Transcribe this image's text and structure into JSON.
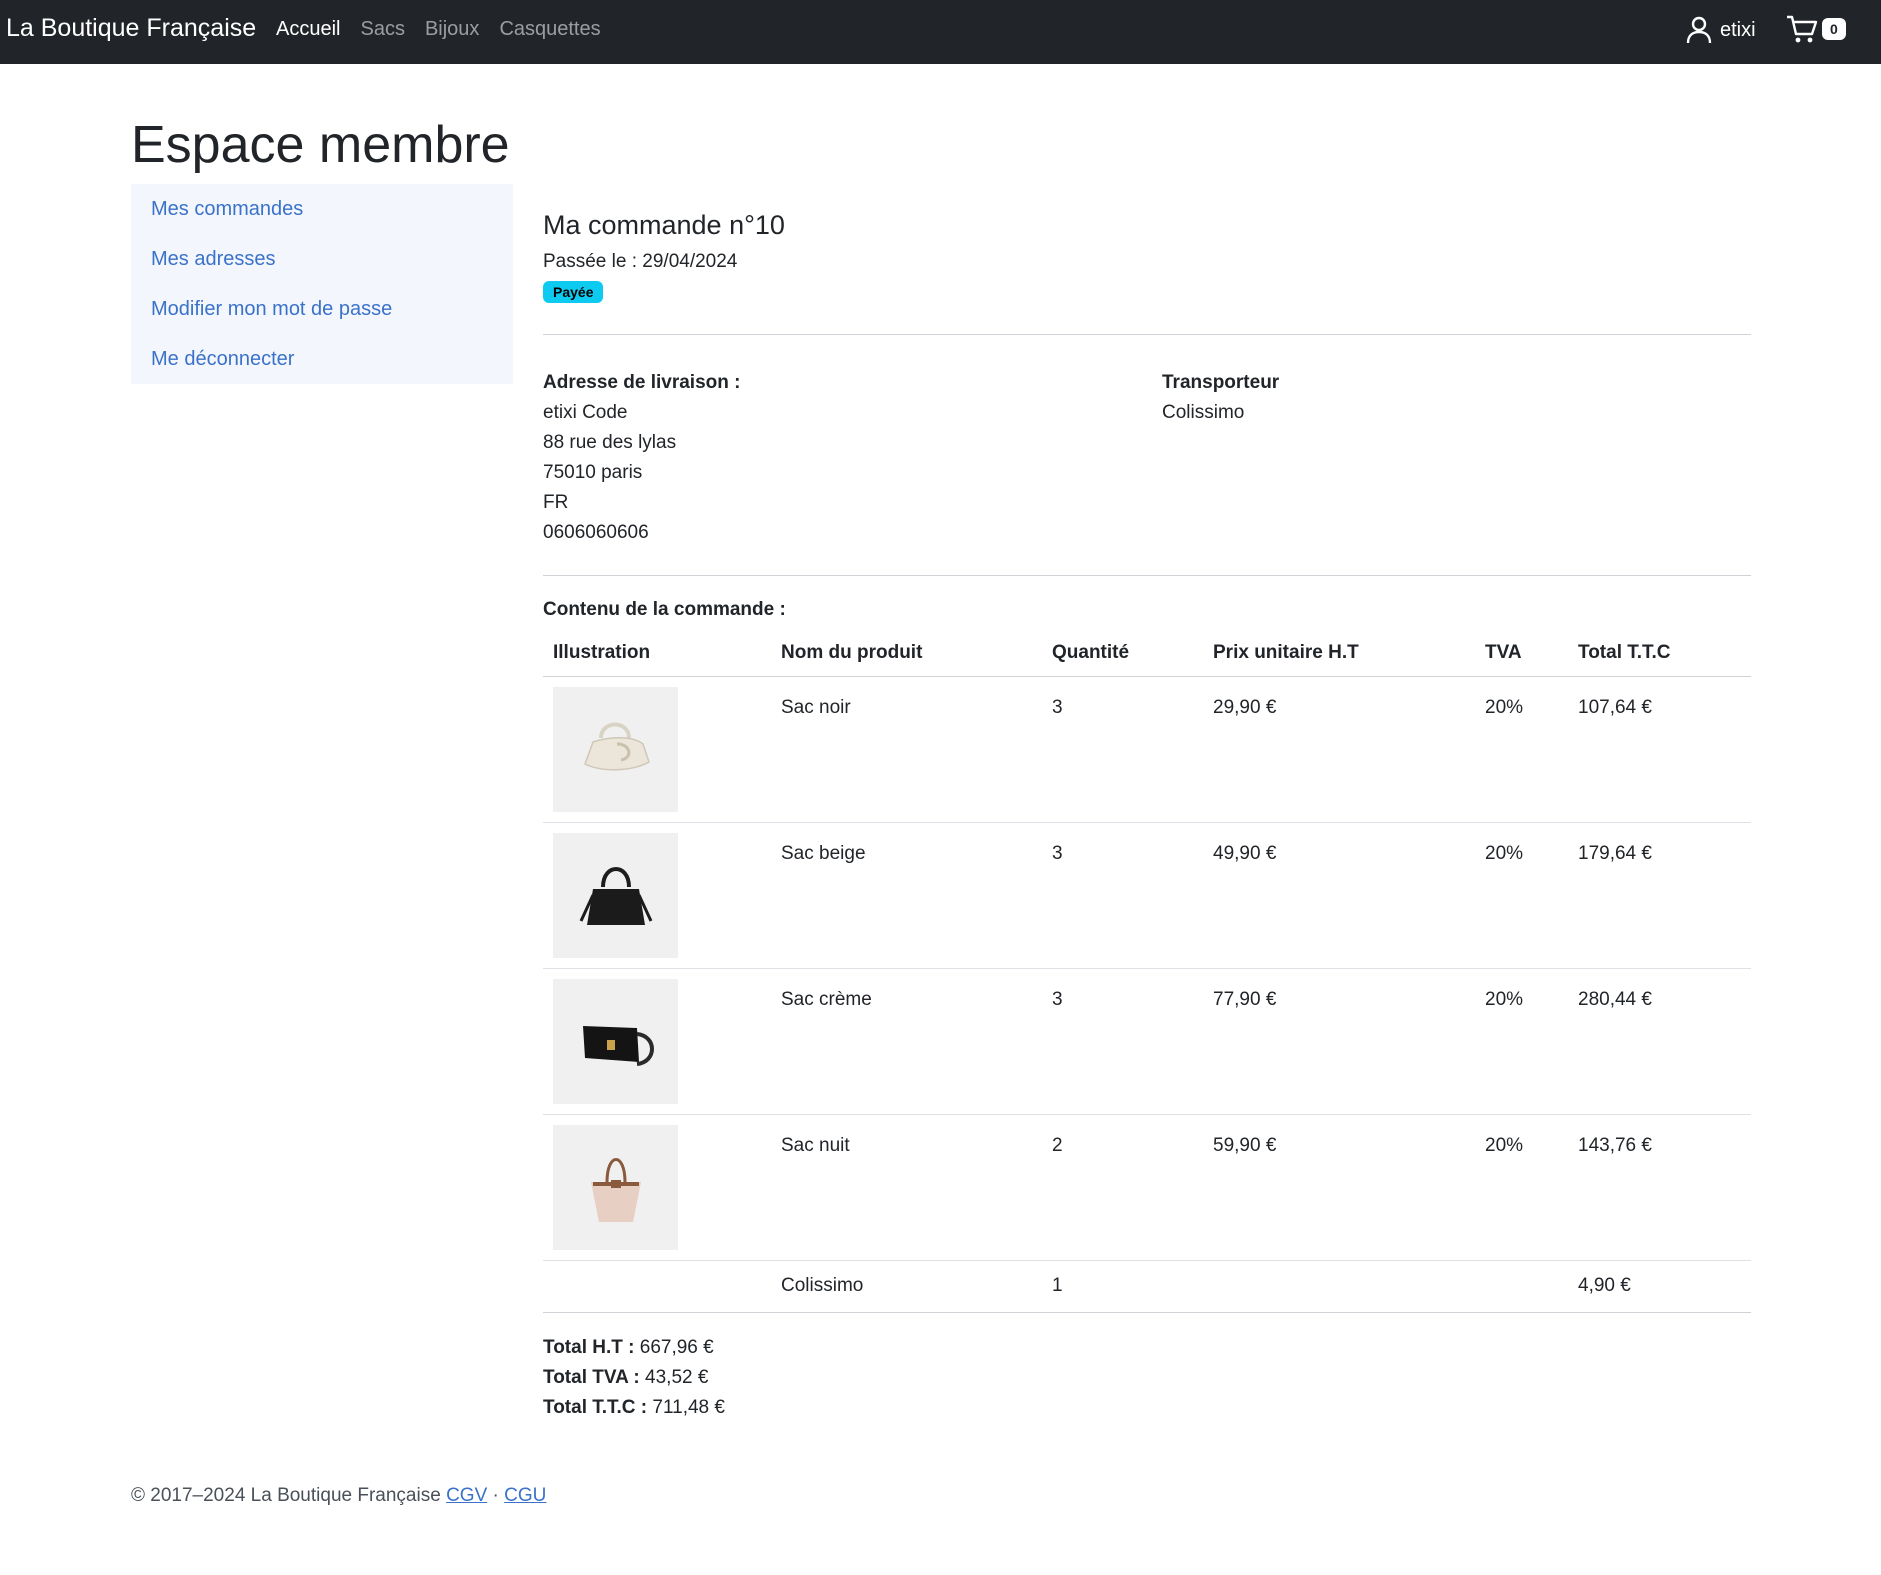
{
  "navbar": {
    "brand": "La Boutique Française",
    "links": [
      {
        "label": "Accueil",
        "active": true
      },
      {
        "label": "Sacs",
        "active": false
      },
      {
        "label": "Bijoux",
        "active": false
      },
      {
        "label": "Casquettes",
        "active": false
      }
    ],
    "user_icon": "user-icon",
    "username": "etixi",
    "cart_icon": "cart-icon",
    "cart_count": "0"
  },
  "page_title": "Espace membre",
  "sidebar": {
    "items": [
      {
        "label": "Mes commandes"
      },
      {
        "label": "Mes adresses"
      },
      {
        "label": "Modifier mon mot de passe"
      },
      {
        "label": "Me déconnecter"
      }
    ]
  },
  "order": {
    "title": "Ma commande n°10",
    "date": "Passée le : 29/04/2024",
    "status": "Payée",
    "status_color": "#0dcaf0"
  },
  "delivery": {
    "label": "Adresse de livraison :",
    "lines": [
      "etixi Code",
      "88 rue des lylas",
      "75010 paris",
      "FR",
      "0606060606"
    ]
  },
  "carrier": {
    "label": "Transporteur",
    "name": "Colissimo"
  },
  "contents": {
    "label": "Contenu de la commande :",
    "headers": [
      "Illustration",
      "Nom du produit",
      "Quantité",
      "Prix unitaire H.T",
      "TVA",
      "Total T.T.C"
    ],
    "rows": [
      {
        "image": "bag-cream-icon",
        "name": "Sac noir",
        "qty": "3",
        "unit_price": "29,90 €",
        "tva": "20%",
        "total": "107,64 €"
      },
      {
        "image": "bag-black-tote-icon",
        "name": "Sac beige",
        "qty": "3",
        "unit_price": "49,90 €",
        "tva": "20%",
        "total": "179,64 €"
      },
      {
        "image": "bag-black-crossbody-icon",
        "name": "Sac crème",
        "qty": "3",
        "unit_price": "77,90 €",
        "tva": "20%",
        "total": "280,44 €"
      },
      {
        "image": "bag-pink-tote-icon",
        "name": "Sac nuit",
        "qty": "2",
        "unit_price": "59,90 €",
        "tva": "20%",
        "total": "143,76 €"
      }
    ],
    "shipping": {
      "name": "Colissimo",
      "qty": "1",
      "total": "4,90 €"
    }
  },
  "totals": {
    "ht_label": "Total H.T :",
    "ht_value": "667,96 €",
    "tva_label": "Total TVA :",
    "tva_value": "43,52 €",
    "ttc_label": "Total T.T.C :",
    "ttc_value": "711,48 €"
  },
  "footer": {
    "text": "© 2017–2024 La Boutique Française",
    "cgv": "CGV",
    "separator": "·",
    "cgu": "CGU"
  }
}
